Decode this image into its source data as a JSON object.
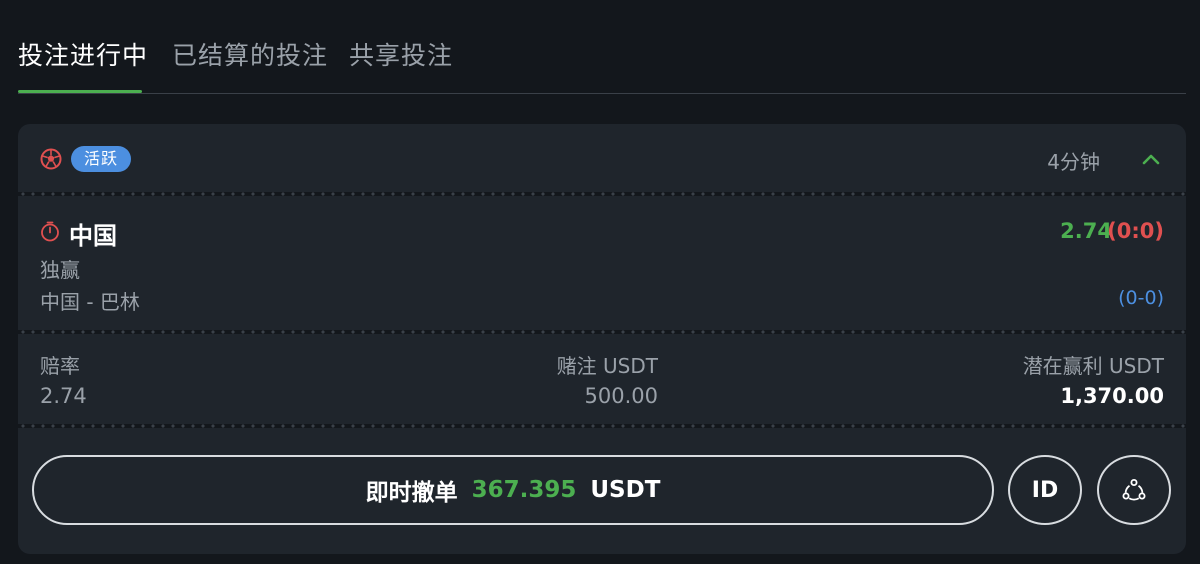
{
  "tabs": [
    {
      "label": "投注进行中",
      "active": true
    },
    {
      "label": "已结算的投注",
      "active": false
    },
    {
      "label": "共享投注",
      "active": false
    }
  ],
  "bet": {
    "sport_icon": "soccer-ball-icon",
    "status": "活跃",
    "elapsed": "4分钟",
    "selection": "中国",
    "live_odds": "2.74",
    "live_score": "(0:0)",
    "market": "独赢",
    "match": "中国 - 巴林",
    "final_score": "(0-0)"
  },
  "stats": {
    "odds_label": "赔率",
    "odds_value": "2.74",
    "stake_label": "赌注 USDT",
    "stake_value": "500.00",
    "potential_label": "潜在赢利 USDT",
    "potential_value": "1,370.00"
  },
  "actions": {
    "cashout_label": "即时撤单",
    "cashout_amount": "367.395",
    "cashout_currency": "USDT",
    "id_label": "ID"
  },
  "colors": {
    "accent_green": "#4caf50",
    "badge_blue": "#4c8fe0",
    "score_red": "#e05050",
    "card_bg": "#1f252c",
    "page_bg": "#13171c"
  }
}
